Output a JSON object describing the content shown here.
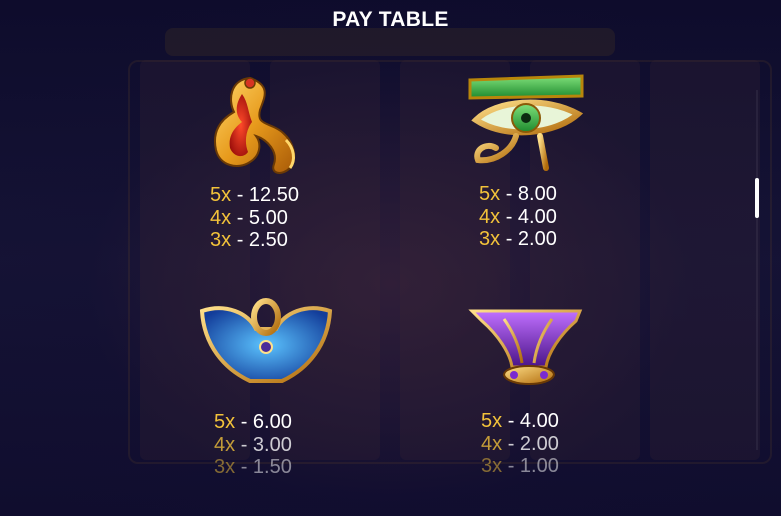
{
  "title": "PAY TABLE",
  "symbols": [
    {
      "icon": "cobra-icon",
      "pays": [
        {
          "mult": "5x",
          "val": "- 12.50"
        },
        {
          "mult": "4x",
          "val": "- 5.00"
        },
        {
          "mult": "3x",
          "val": "- 2.50"
        }
      ]
    },
    {
      "icon": "eye-of-horus-icon",
      "pays": [
        {
          "mult": "5x",
          "val": "- 8.00"
        },
        {
          "mult": "4x",
          "val": "- 4.00"
        },
        {
          "mult": "3x",
          "val": "- 2.00"
        }
      ]
    },
    {
      "icon": "winged-ankh-icon",
      "pays": [
        {
          "mult": "5x",
          "val": "- 6.00"
        },
        {
          "mult": "4x",
          "val": "- 3.00"
        },
        {
          "mult": "3x",
          "val": "- 1.50"
        }
      ]
    },
    {
      "icon": "lotus-scarab-icon",
      "pays": [
        {
          "mult": "5x",
          "val": "- 4.00"
        },
        {
          "mult": "4x",
          "val": "- 2.00"
        },
        {
          "mult": "3x",
          "val": "- 1.00"
        }
      ]
    }
  ],
  "colors": {
    "multiplier": "#f2c23a",
    "value": "#ffffff",
    "background": "#0c0b2a"
  }
}
